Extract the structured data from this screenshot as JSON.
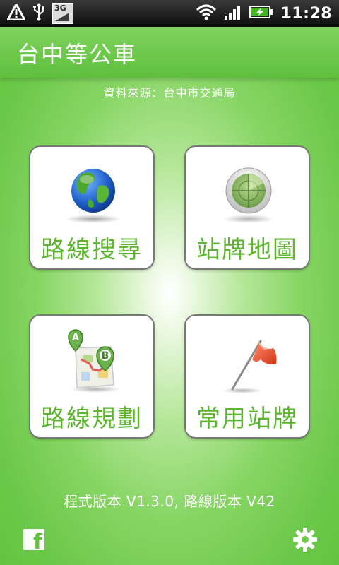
{
  "status_bar": {
    "time": "11:28",
    "network_label": "3G",
    "icons": [
      "warning-icon",
      "usb-icon",
      "3g-icon",
      "wifi-icon",
      "signal-icon",
      "battery-charging-icon"
    ]
  },
  "app": {
    "title": "台中等公車",
    "source": "資料來源：台中市交通局"
  },
  "menu": {
    "items": [
      {
        "label": "路線搜尋",
        "icon": "globe-icon"
      },
      {
        "label": "站牌地圖",
        "icon": "radar-icon"
      },
      {
        "label": "路線規劃",
        "icon": "map-route-icon"
      },
      {
        "label": "常用站牌",
        "icon": "flag-icon"
      }
    ]
  },
  "footer": {
    "version": "程式版本 V1.3.0, 路線版本 V42",
    "facebook_glyph": "f",
    "icons": [
      "facebook-icon",
      "gear-icon"
    ]
  },
  "colors": {
    "background": "#6cc849",
    "title_bar": "#6ecb4b",
    "tile_label": "#5cb52f",
    "tile_border": "#777777"
  }
}
